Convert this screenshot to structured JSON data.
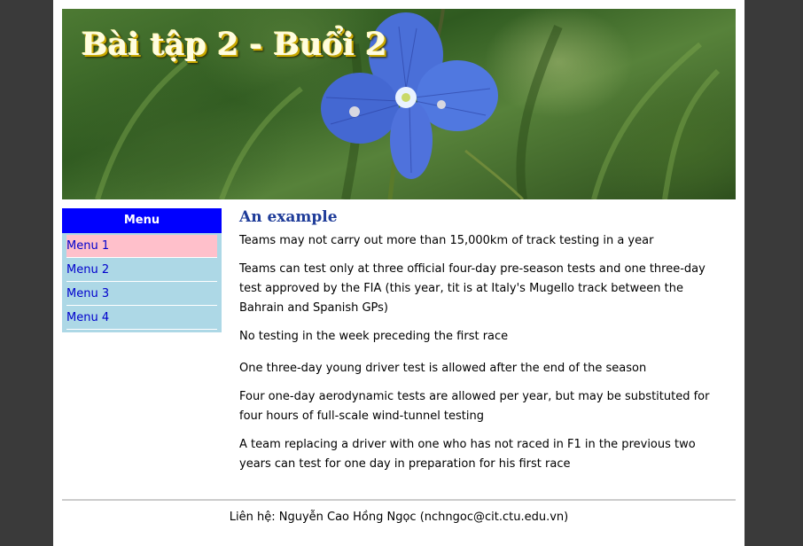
{
  "banner": {
    "title": "Bài tập 2 - Buổi 2"
  },
  "sidebar": {
    "title": "Menu",
    "items": [
      {
        "label": "Menu 1",
        "active": true
      },
      {
        "label": "Menu 2",
        "active": false
      },
      {
        "label": "Menu 3",
        "active": false
      },
      {
        "label": "Menu 4",
        "active": false
      }
    ]
  },
  "main": {
    "heading": "An example",
    "paragraphs": [
      "Teams may not carry out more than 15,000km of track testing in a year",
      "Teams can test only at three official four-day pre-season tests and one three-day test approved by the FIA (this year, tit is at Italy's Mugello track between the Bahrain and Spanish GPs)",
      "No testing in the week preceding the first race",
      "One three-day young driver test is allowed after the end of the season",
      "Four one-day aerodynamic tests are allowed per year, but may be substituted for four hours of full-scale wind-tunnel testing",
      "A team replacing a driver with one who has not raced in F1 in the previous two years can test for one day in preparation for his first race"
    ]
  },
  "footer": {
    "text": "Liên hệ: Nguyễn Cao Hồng Ngọc (nchngoc@cit.ctu.edu.vn)"
  },
  "colors": {
    "outer_background": "#3a3a3a",
    "menu_header": "#0000ff",
    "menu_background": "#add8e6",
    "menu_active": "#ffc0cb",
    "heading": "#1f3c99"
  }
}
